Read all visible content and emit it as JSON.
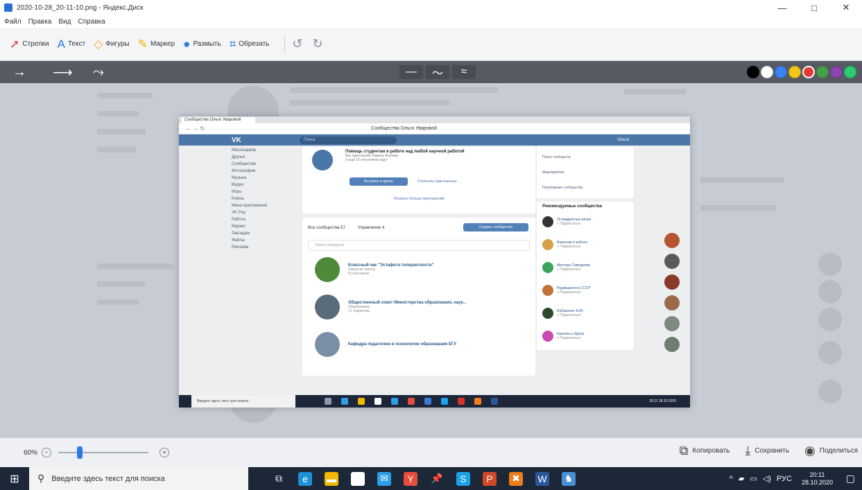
{
  "window": {
    "title": "2020-10-28_20-11-10.png - Яндекс.Диск",
    "controls": [
      "—",
      "□",
      "✕"
    ]
  },
  "menu": [
    "Файл",
    "Правка",
    "Вид",
    "Справка"
  ],
  "toolbar": {
    "tools": [
      {
        "label": "Стрелки",
        "icon": "arrow-tool-icon",
        "glyph": "➚",
        "color": "#e23b3b",
        "active": true
      },
      {
        "label": "Текст",
        "icon": "text-tool-icon",
        "glyph": "A",
        "color": "#2c7be5"
      },
      {
        "label": "Фигуры",
        "icon": "shapes-tool-icon",
        "glyph": "◇",
        "color": "#f5a623"
      },
      {
        "label": "Маркер",
        "icon": "marker-tool-icon",
        "glyph": "✎",
        "color": "#f0b400"
      },
      {
        "label": "Размыть",
        "icon": "blur-tool-icon",
        "glyph": "●",
        "color": "#2c7be5"
      },
      {
        "label": "Обрезать",
        "icon": "crop-tool-icon",
        "glyph": "⌗",
        "color": "#2c7be5"
      }
    ]
  },
  "options": {
    "arrows": [
      "→",
      "⟶",
      "⤳"
    ],
    "strokes": [
      "—",
      "〜",
      "≈"
    ],
    "colors": [
      "#000000",
      "#ffffff",
      "#3b82f6",
      "#f5c518",
      "#e53935",
      "#43a047",
      "#8e44ad",
      "#2ecc71"
    ]
  },
  "inner": {
    "tab": "Сообщества Ольги Уваровой",
    "url": "Сообщества Ольги Уваровой",
    "search_placeholder": "Поиск",
    "user": "Ольга",
    "menu": [
      "Мессенджер",
      "Друзья",
      "Сообщества",
      "Фотографии",
      "Музыка",
      "Видео",
      "Игры",
      "Клипы",
      "Мини-приложения",
      "VK Pay",
      "Работа",
      "Маркет",
      "Закладки",
      "Файлы",
      "Реклама"
    ],
    "promo": {
      "title": "Помощь студентам в работе над любой научной работой",
      "line1": "Вас приглашает Карина Ягупова",
      "line2": "и ещё 15 участников ждут",
      "join": "Вступить в группу",
      "skip": "Отклонить приглашение",
      "more": "Показать больше приглашений"
    },
    "tabs": [
      "Все сообщества 57",
      "Управление 4"
    ],
    "create": "Создать сообщество",
    "search_communities": "Поиск сообществ",
    "communities": [
      {
        "title": "Классный час \"Эстафета толерантности\"",
        "sub": "Закрытая группа",
        "count": "8 участников",
        "color": "#4f8a3c"
      },
      {
        "title": "Общественный совет Министерства образования, наук...",
        "sub": "Образование",
        "count": "21 подписчик",
        "color": "#5a6b7a"
      },
      {
        "title": "Кафедра педагогики и психологии образования ЕГУ",
        "sub": "",
        "count": "",
        "color": "#7a8fa6"
      }
    ],
    "right_links": [
      "Поиск сообществ",
      "Мероприятия",
      "Популярные сообщества"
    ],
    "rec_title": "Рекомендуемые сообщества",
    "recs": [
      {
        "name": "33 квадратных метра",
        "tag": "+ Подписаться",
        "color": "#333333"
      },
      {
        "name": "Вакансии и работа",
        "tag": "+ Подписаться",
        "color": "#d9a04a"
      },
      {
        "name": "Мастера Самоделки",
        "tag": "+ Подписаться",
        "color": "#3aa35c"
      },
      {
        "name": "Родившиеся в СССР",
        "tag": "+ Подписаться",
        "color": "#c0723a"
      },
      {
        "name": "Избранное SciFi",
        "tag": "+ Подписаться",
        "color": "#2e4a2e"
      },
      {
        "name": "Картины и Декор",
        "tag": "+ Подписаться",
        "color": "#c94ab0"
      }
    ],
    "side_avatars": [
      "#b5542e",
      "#5a5a5a",
      "#8b3a2a",
      "#9a6a4a",
      "#7d8a7d",
      "#6e7d6e"
    ],
    "taskbar_search": "Введите здесь текст для поиска",
    "taskbar_icons": [
      "#8a9bb0",
      "#2e9ee6",
      "#f2b700",
      "#ffffff",
      "#2e9ee6",
      "#e74c3c",
      "#3a7bd5",
      "#1da1f2",
      "#d9342b",
      "#f07c1a",
      "#2b579a"
    ],
    "clock": "20:11  28.10.2020"
  },
  "status": {
    "zoom": "60%",
    "zoom_level": 0.22,
    "copy": "Копировать",
    "save": "Сохранить",
    "share": "Поделиться"
  },
  "taskbar": {
    "search": "Введите здесь текст для поиска",
    "icons": [
      {
        "name": "task-view-icon",
        "color": "transparent",
        "glyph": "⧉"
      },
      {
        "name": "edge-icon",
        "color": "#1e90d6",
        "glyph": "e"
      },
      {
        "name": "file-explorer-icon",
        "color": "#f2b700",
        "glyph": "▬"
      },
      {
        "name": "store-icon",
        "color": "#ffffff",
        "glyph": "⛁"
      },
      {
        "name": "mail-icon",
        "color": "#2e9ee6",
        "glyph": "✉"
      },
      {
        "name": "yandex-browser-icon",
        "color": "#e74c3c",
        "glyph": "Y"
      },
      {
        "name": "pin-icon",
        "color": "transparent",
        "glyph": "📌"
      },
      {
        "name": "skype-icon",
        "color": "#1aa3e8",
        "glyph": "S"
      },
      {
        "name": "powerpoint-icon",
        "color": "#d24726",
        "glyph": "P"
      },
      {
        "name": "paint-icon",
        "color": "#f07c1a",
        "glyph": "✖"
      },
      {
        "name": "word-icon",
        "color": "#2b579a",
        "glyph": "W"
      },
      {
        "name": "app-icon",
        "color": "#4a90d9",
        "glyph": "♞"
      }
    ],
    "lang": "РУС",
    "time": "20:11",
    "date": "28.10.2020"
  }
}
